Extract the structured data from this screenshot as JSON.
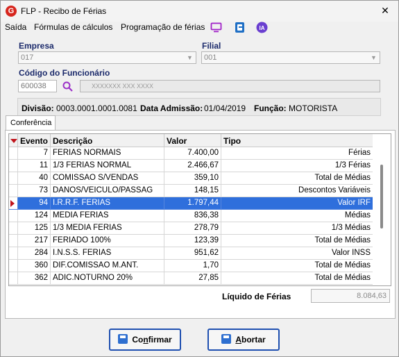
{
  "window": {
    "title": "FLP - Recibo de Férias",
    "close_symbol": "✕"
  },
  "menu": [
    {
      "label": "Saída"
    },
    {
      "label": "Fórmulas de cálculos"
    },
    {
      "label": "Programação de férias"
    }
  ],
  "menu_icons": [
    "monitor-icon",
    "book-icon",
    "ai-icon"
  ],
  "menu_ai_label": "IA",
  "form": {
    "empresa_label": "Empresa",
    "empresa_value": "017",
    "filial_label": "Filial",
    "filial_value": "001",
    "funcionario_label": "Código do Funcionário",
    "funcionario_code": "600038",
    "funcionario_name": "XXXXXXX XXX XXXX"
  },
  "info": {
    "divisao_label": "Divisão:",
    "divisao_value": "0003.0001.0001.0081",
    "admissao_label": "Data Admissão:",
    "admissao_value": "01/04/2019",
    "funcao_label": "Função:",
    "funcao_value": "MOTORISTA"
  },
  "tab": {
    "label": "Conferência"
  },
  "grid": {
    "columns": [
      "Evento",
      "Descrição",
      "Valor",
      "Tipo"
    ],
    "rows": [
      {
        "evento": "7",
        "descricao": "FERIAS NORMAIS",
        "valor": "7.400,00",
        "tipo": "Férias"
      },
      {
        "evento": "11",
        "descricao": "1/3 FERIAS NORMAL",
        "valor": "2.466,67",
        "tipo": "1/3 Férias"
      },
      {
        "evento": "40",
        "descricao": "COMISSAO S/VENDAS",
        "valor": "359,10",
        "tipo": "Total de Médias"
      },
      {
        "evento": "73",
        "descricao": "DANOS/VEICULO/PASSAG",
        "valor": "148,15",
        "tipo": "Descontos Variáveis"
      },
      {
        "evento": "94",
        "descricao": "I.R.R.F. FERIAS",
        "valor": "1.797,44",
        "tipo": "Valor IRF"
      },
      {
        "evento": "124",
        "descricao": "MEDIA FERIAS",
        "valor": "836,38",
        "tipo": "Médias"
      },
      {
        "evento": "125",
        "descricao": "1/3 MEDIA FERIAS",
        "valor": "278,79",
        "tipo": "1/3 Médias"
      },
      {
        "evento": "217",
        "descricao": "FERIADO 100%",
        "valor": "123,39",
        "tipo": "Total de Médias"
      },
      {
        "evento": "284",
        "descricao": "I.N.S.S. FERIAS",
        "valor": "951,62",
        "tipo": "Valor INSS"
      },
      {
        "evento": "360",
        "descricao": "DIF.COMISSAO M.ANT.",
        "valor": "1,70",
        "tipo": "Total de Médias"
      },
      {
        "evento": "362",
        "descricao": "ADIC.NOTURNO 20%",
        "valor": "27,85",
        "tipo": "Total de Médias"
      }
    ],
    "selected_index": 4
  },
  "liquido": {
    "label": "Líquido de Férias",
    "value": "8.084,63"
  },
  "buttons": {
    "confirmar_first": "Co",
    "confirmar_u": "n",
    "confirmar_rest": "firmar",
    "abortar_u": "A",
    "abortar_rest": "bortar"
  },
  "colors": {
    "selection": "#2f6fdc",
    "label_blue": "#1b2a6b",
    "button_border": "#1e4fb0",
    "marker_red": "#c0141b"
  }
}
